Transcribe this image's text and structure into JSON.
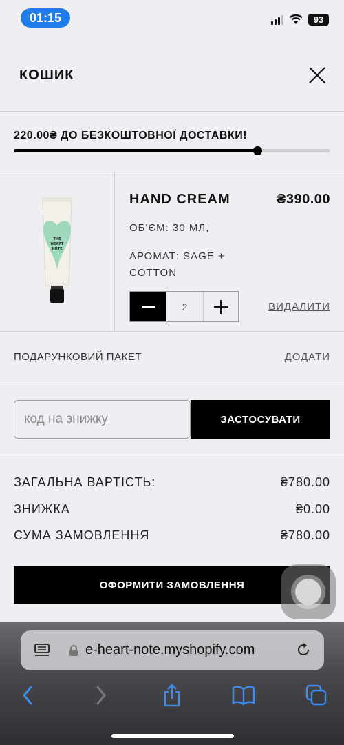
{
  "status_bar": {
    "time": "01:15",
    "battery": "93"
  },
  "cart": {
    "title": "КОШИК",
    "shipping_message": "220.00₴ ДО БЕЗКОШТОВНОЇ ДОСТАВКИ!",
    "shipping_progress": 0.77
  },
  "product": {
    "name": "HAND CREAM",
    "price": "₴390.00",
    "volume": "ОБ'ЄМ: 30 МЛ,",
    "scent": "АРОМАТ: SAGE + COTTON",
    "quantity": "2",
    "remove_label": "ВИДАЛИТИ",
    "tube_brand_text": "THE HEART NOTE"
  },
  "gift": {
    "label": "ПОДАРУНКОВИЙ ПАКЕТ",
    "add_label": "ДОДАТИ"
  },
  "discount": {
    "placeholder": "код на знижку",
    "apply_label": "ЗАСТОСУВАТИ"
  },
  "totals": {
    "subtotal_label": "ЗАГАЛЬНА ВАРТІСТЬ:",
    "subtotal_value": "₴780.00",
    "discount_label": "ЗНИЖКА",
    "discount_value": "₴0.00",
    "order_label": "СУМА ЗАМОВЛЕННЯ",
    "order_value": "₴780.00"
  },
  "checkout_label": "ОФОРМИТИ ЗАМОВЛЕННЯ",
  "browser": {
    "url": "e-heart-note.myshopify.com"
  },
  "colors": {
    "accent_blue": "#1f7ce8",
    "dark": "#000000",
    "background": "#efeef2"
  }
}
